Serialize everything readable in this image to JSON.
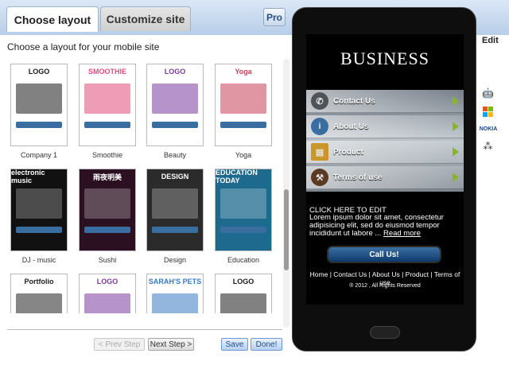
{
  "tabs": [
    {
      "label": "Choose layout"
    },
    {
      "label": "Customize site"
    }
  ],
  "pro_label": "Pro",
  "intro": "Choose a layout for your mobile site",
  "layouts": [
    {
      "name": "Company 1",
      "thumb_title": "LOGO",
      "color": "#1a1a1a"
    },
    {
      "name": "Smoothie",
      "thumb_title": "SMOOTHIE",
      "color": "#e24a7a"
    },
    {
      "name": "Beauty",
      "thumb_title": "LOGO",
      "color": "#7b3aa2"
    },
    {
      "name": "Yoga",
      "thumb_title": "Yoga",
      "color": "#c8405a"
    },
    {
      "name": "DJ - music",
      "thumb_title": "electronic music",
      "color": "#111111"
    },
    {
      "name": "Sushi",
      "thumb_title": "雨夜明美",
      "color": "#2a1020"
    },
    {
      "name": "Design",
      "thumb_title": "DESIGN",
      "color": "#2b2b2b"
    },
    {
      "name": "Education",
      "thumb_title": "EDUCATION TODAY",
      "color": "#1e6a8e"
    },
    {
      "name": "",
      "thumb_title": "Portfolio",
      "color": "#222222"
    },
    {
      "name": "",
      "thumb_title": "LOGO",
      "color": "#7b3aa2"
    },
    {
      "name": "",
      "thumb_title": "SARAH'S PETS",
      "color": "#3a7ac2"
    },
    {
      "name": "",
      "thumb_title": "LOGO",
      "color": "#1a1a1a"
    }
  ],
  "buttons": {
    "prev": "< Prev Step",
    "next": "Next Step >",
    "save": "Save",
    "done": "Done!"
  },
  "preview": {
    "title": "BUSINESS",
    "menu": [
      {
        "label": "Contact Us",
        "icon": "phone-icon"
      },
      {
        "label": "About Us",
        "icon": "info-icon"
      },
      {
        "label": "Product",
        "icon": "gold-bars-icon"
      },
      {
        "label": "Terms of use",
        "icon": "gavel-icon"
      }
    ],
    "click_here": "CLICK HERE TO EDIT",
    "lorem": "Lorem ipsum dolor sit amet, consectetur adipisicing elit, sed do eiusmod tempor incididunt ut labore ...",
    "read_more": "Read more",
    "call_label": "Call Us!",
    "footer_links": "Home | Contact Us | About Us | Product | Terms of use",
    "copyright": "® 2012 , All Rights Reserved"
  },
  "side": {
    "edit": "Edit",
    "platforms": [
      "apple-icon",
      "android-icon",
      "windows-icon",
      "nokia-icon",
      "blackberry-icon"
    ],
    "nokia_text": "NOKIA"
  },
  "colors": {
    "accent": "#89b42c",
    "call_button": "#1b4a80",
    "header_bg": "#c6d9ef"
  }
}
